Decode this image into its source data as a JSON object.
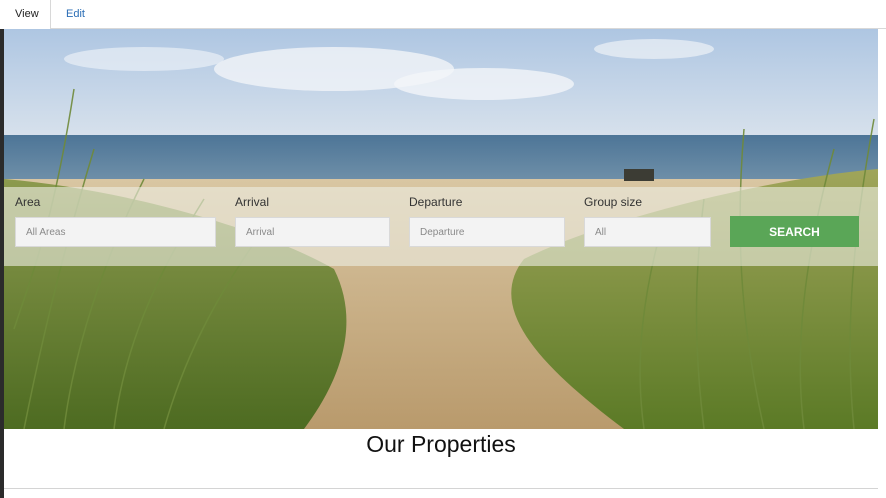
{
  "tabs": [
    {
      "label": "View"
    },
    {
      "label": "Edit"
    }
  ],
  "search": {
    "area": {
      "label": "Area",
      "placeholder": "All Areas"
    },
    "arrival": {
      "label": "Arrival",
      "placeholder": "Arrival"
    },
    "departure": {
      "label": "Departure",
      "placeholder": "Departure"
    },
    "group_size": {
      "label": "Group size",
      "placeholder": "All"
    },
    "button_label": "SEARCH"
  },
  "section": {
    "title": "Our Properties"
  },
  "colors": {
    "accent": "#5aa657",
    "link": "#2a6db5"
  }
}
